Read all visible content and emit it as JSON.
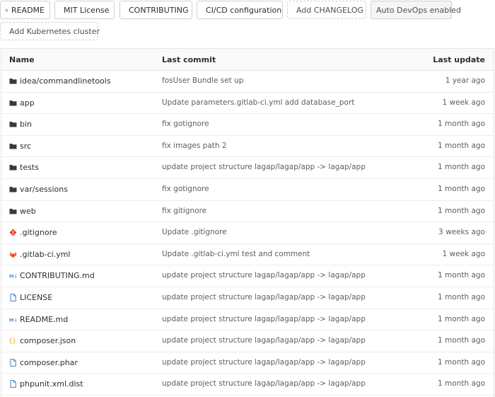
{
  "quick_links": {
    "readme": "README",
    "license": "MIT License",
    "contributing": "CONTRIBUTING",
    "cicd": "CI/CD configuration",
    "changelog": "Add CHANGELOG",
    "autodevops": "Auto DevOps enabled",
    "kubernetes": "Add Kubernetes cluster"
  },
  "table": {
    "headers": {
      "name": "Name",
      "commit": "Last commit",
      "update": "Last update"
    },
    "rows": [
      {
        "name": "idea/commandlinetools",
        "commit": "fosUser Bundle set up",
        "update": "1 year ago",
        "icon": "folder-icon"
      },
      {
        "name": "app",
        "commit": "Update parameters.gitlab-ci.yml add database_port",
        "update": "1 week ago",
        "icon": "folder-icon"
      },
      {
        "name": "bin",
        "commit": "fix gotignore",
        "update": "1 month ago",
        "icon": "folder-icon"
      },
      {
        "name": "src",
        "commit": "fix images path 2",
        "update": "1 month ago",
        "icon": "folder-icon"
      },
      {
        "name": "tests",
        "commit": "update project structure lagap/lagap/app -> lagap/app",
        "update": "1 month ago",
        "icon": "folder-icon"
      },
      {
        "name": "var/sessions",
        "commit": "fix gotignore",
        "update": "1 month ago",
        "icon": "folder-icon"
      },
      {
        "name": "web",
        "commit": "fix gitignore",
        "update": "1 month ago",
        "icon": "folder-icon"
      },
      {
        "name": ".gitignore",
        "commit": "Update .gitignore",
        "update": "3 weeks ago",
        "icon": "git-icon"
      },
      {
        "name": ".gitlab-ci.yml",
        "commit": "Update .gitlab-ci.yml test and comment",
        "update": "1 week ago",
        "icon": "gitlab-icon"
      },
      {
        "name": "CONTRIBUTING.md",
        "commit": "update project structure lagap/lagap/app -> lagap/app",
        "update": "1 month ago",
        "icon": "markdown-icon"
      },
      {
        "name": "LICENSE",
        "commit": "update project structure lagap/lagap/app -> lagap/app",
        "update": "1 month ago",
        "icon": "file-icon"
      },
      {
        "name": "README.md",
        "commit": "update project structure lagap/lagap/app -> lagap/app",
        "update": "1 month ago",
        "icon": "markdown-icon"
      },
      {
        "name": "composer.json",
        "commit": "update project structure lagap/lagap/app -> lagap/app",
        "update": "1 month ago",
        "icon": "json-icon"
      },
      {
        "name": "composer.phar",
        "commit": "update project structure lagap/lagap/app -> lagap/app",
        "update": "1 month ago",
        "icon": "file-icon"
      },
      {
        "name": "phpunit.xml.dist",
        "commit": "update project structure lagap/lagap/app -> lagap/app",
        "update": "1 month ago",
        "icon": "file-icon"
      }
    ]
  },
  "colors": {
    "folder": "#3a3a3a",
    "git": "#e24329",
    "gitlab": "#fc6d26",
    "markdown": "#4a90d9",
    "json": "#e8a000",
    "file": "#3b82c4"
  }
}
